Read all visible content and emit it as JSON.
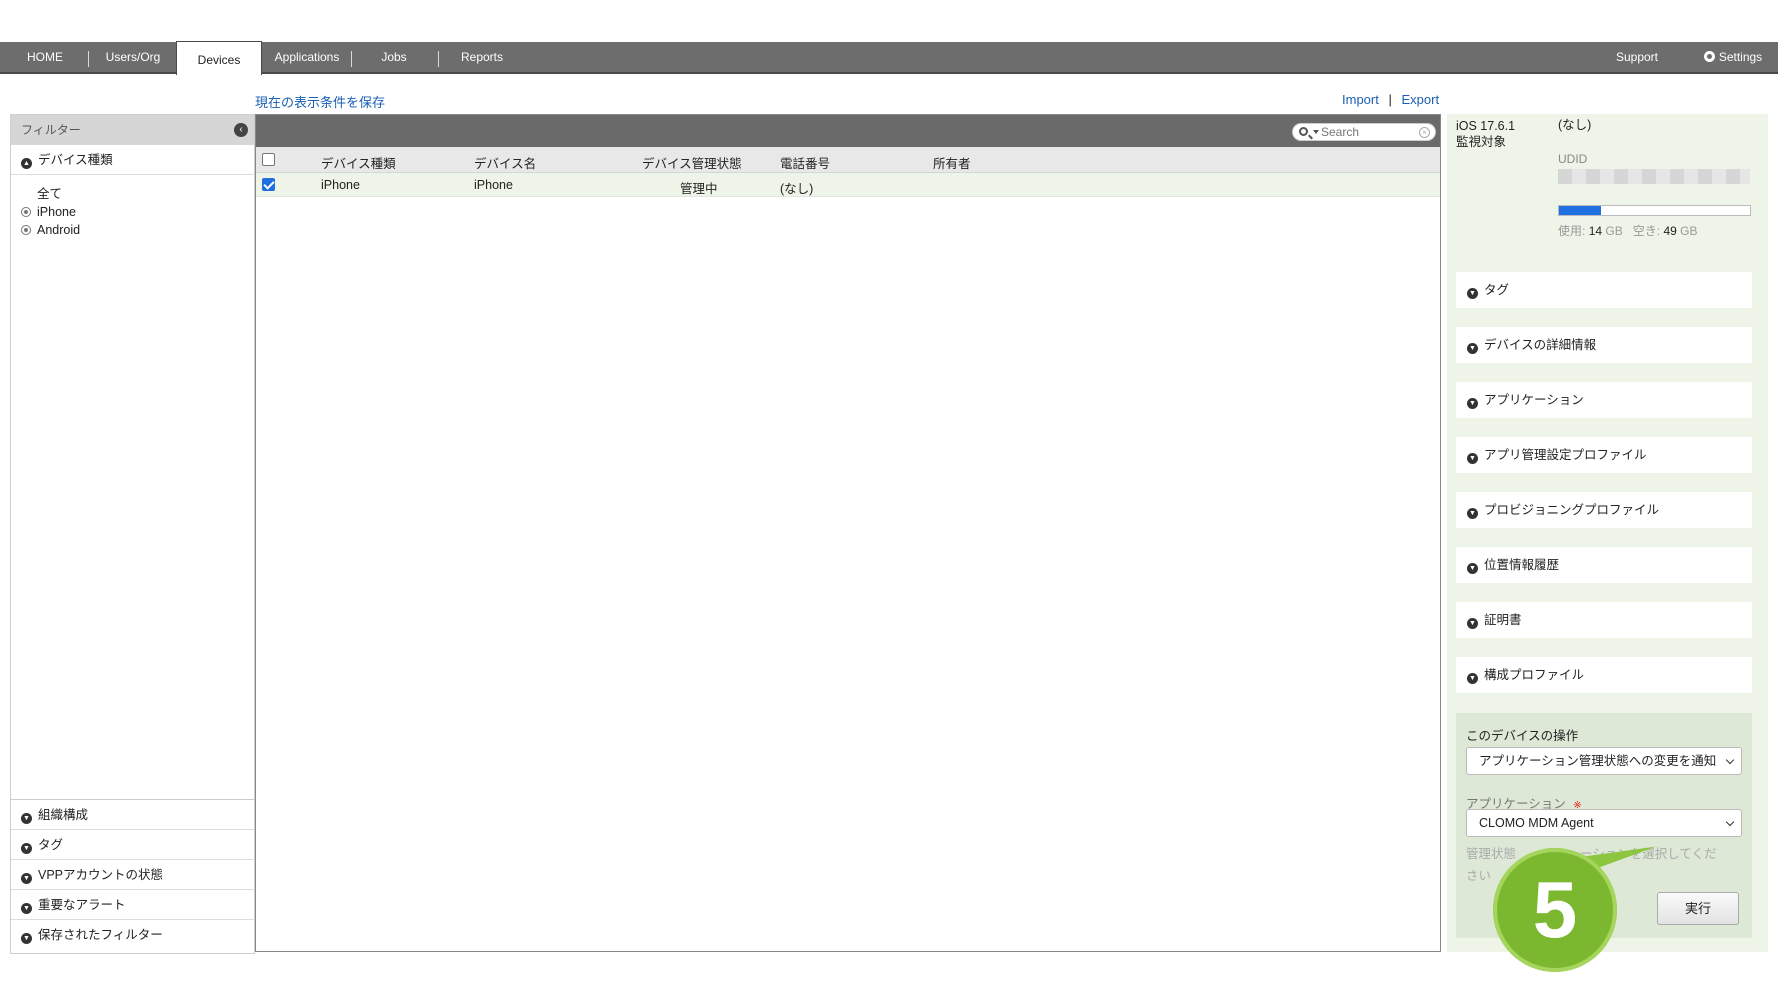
{
  "nav": {
    "items": [
      "HOME",
      "Users/Org",
      "Devices",
      "Applications",
      "Jobs",
      "Reports"
    ],
    "support": "Support",
    "settings": "Settings"
  },
  "toolbar": {
    "save_view": "現在の表示条件を保存",
    "import": "Import",
    "separator": "|",
    "export": "Export"
  },
  "filter": {
    "title": "フィルター",
    "device_type": "デバイス種類",
    "options": [
      "全て",
      "iPhone",
      "Android"
    ],
    "sections": [
      "組織構成",
      "タグ",
      "VPPアカウントの状態",
      "重要なアラート",
      "保存されたフィルター"
    ]
  },
  "table": {
    "search_placeholder": "Search",
    "columns": [
      "デバイス種類",
      "デバイス名",
      "デバイス管理状態",
      "電話番号",
      "所有者"
    ],
    "rows": [
      {
        "type": "iPhone",
        "name": "iPhone",
        "status": "管理中",
        "phone": "(なし)",
        "owner": ""
      }
    ]
  },
  "detail": {
    "os": "iOS 17.6.1",
    "supervised": "監視対象",
    "none_value": "(なし)",
    "udid_label": "UDID",
    "storage_used_label": "使用:",
    "storage_used": "14",
    "storage_free_label": "空き:",
    "storage_free": "49",
    "unit": "GB",
    "storage_used_fraction": 0.22,
    "sections": [
      "タグ",
      "デバイスの詳細情報",
      "アプリケーション",
      "アプリ管理設定プロファイル",
      "プロビジョニングプロファイル",
      "位置情報履歴",
      "証明書",
      "構成プロファイル"
    ]
  },
  "operations": {
    "title": "このデバイスの操作",
    "action": "アプリケーション管理状態への変更を通知",
    "app_label": "アプリケーション",
    "required_mark": "※",
    "app_value": "CLOMO MDM Agent",
    "help_left": "管理状態",
    "help_right": "ーションを選択してくだ",
    "help_line2": "さい",
    "run": "実行"
  },
  "step_marker": "5",
  "colors": {
    "nav_bg": "#6d6d6d",
    "accent_green": "#7cb82f",
    "panel_green": "#eef5e8",
    "link_blue": "#1a5fb4",
    "storage_bar": "#1f6fe0"
  }
}
